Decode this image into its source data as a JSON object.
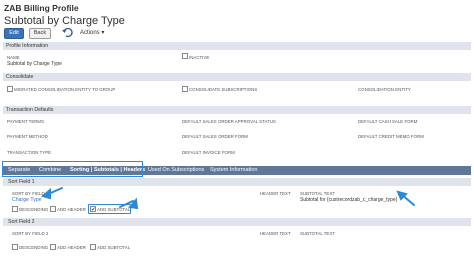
{
  "header": {
    "title": "ZAB Billing Profile",
    "subtitle": "Subtotal by Charge Type"
  },
  "toolbar": {
    "edit_label": "Edit",
    "back_label": "Back",
    "actions_label": "Actions ▾",
    "undo_icon": "undo-icon"
  },
  "profile_info": {
    "header": "Profile Information",
    "name_label": "NAME",
    "name_value": "Subtotal by Charge Type",
    "inactive_label": "INACTIVE"
  },
  "consolidate": {
    "header": "Consolidate",
    "migrated_label": "MIGRATED CONSOLIDATION ENTITY TO GROUP",
    "consolidate_subs_label": "CONSOLIDATE SUBSCRIPTIONS",
    "consolidation_entity_label": "CONSOLIDATION ENTITY"
  },
  "transaction_defaults": {
    "header": "Transaction Defaults",
    "payment_terms": "PAYMENT TERMS",
    "payment_method": "PAYMENT METHOD",
    "transaction_type": "TRANSACTION TYPE",
    "default_sales_order_approval": "DEFAULT SALES ORDER APPROVAL STATUS",
    "default_sales_order_form": "DEFAULT SALES ORDER FORM",
    "default_invoice_form": "DEFAULT INVOICE FORM",
    "default_cash_sale_form": "DEFAULT CASH SALE FORM",
    "default_credit_memo_form": "DEFAULT CREDIT MEMO FORM"
  },
  "tabs": [
    {
      "label": "Separate"
    },
    {
      "label": "Combine"
    },
    {
      "label": "Sorting | Subtotals | Headers"
    },
    {
      "label": "Used On Subscriptions"
    },
    {
      "label": "System Information"
    }
  ],
  "sort1": {
    "header": "Sort Field 1",
    "sort_by_label": "SORT BY FIELD 1",
    "sort_by_value": "Charge Type",
    "descending_label": "DESCENDING",
    "add_header_label": "ADD HEADER",
    "add_subtotal_label": "ADD SUBTOTAL",
    "header_text_label": "HEADER TEXT",
    "subtotal_text_label": "SUBTOTAL TEXT",
    "subtotal_text_value": "Subtotal for {custrecordzab_c_charge_type}"
  },
  "sort2": {
    "header": "Sort Field 2",
    "sort_by_label": "SORT BY FIELD 2",
    "descending_label": "DESCENDING",
    "add_header_label": "ADD HEADER",
    "add_subtotal_label": "ADD SUBTOTAL",
    "header_text_label": "HEADER TEXT",
    "subtotal_text_label": "SUBTOTAL TEXT"
  },
  "colors": {
    "accent": "#2b8ad6",
    "tab_bar": "#607799",
    "section_bg": "#dfe4ec"
  }
}
